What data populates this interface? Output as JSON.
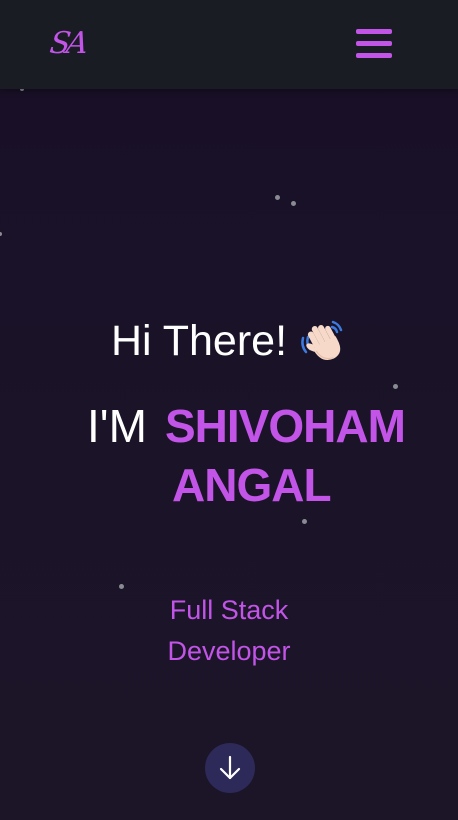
{
  "navbar": {
    "logo_text": "SA",
    "menu_icon": "hamburger-menu-icon"
  },
  "hero": {
    "greeting": "Hi There!",
    "wave_icon": "waving-hand-icon",
    "name_prefix": "I'M",
    "name_first": "SHIVOHAM",
    "name_last": "ANGAL",
    "role_line1": "Full Stack",
    "role_line2": "Developer",
    "scroll_icon": "arrow-down-icon"
  },
  "colors": {
    "accent": "#c254e8",
    "background": "#1b1429",
    "navbar": "#1a1c24",
    "scroll_button": "#2d2a5a",
    "text": "#ffffff"
  }
}
